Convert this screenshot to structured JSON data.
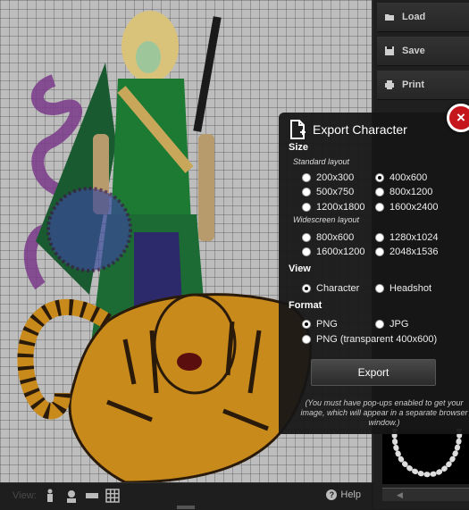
{
  "right_panel": {
    "load_label": "Load",
    "save_label": "Save",
    "print_label": "Print"
  },
  "bottom_bar": {
    "view_label": "View:",
    "help_label": "Help"
  },
  "modal": {
    "title": "Export Character",
    "close_label": "×",
    "size": {
      "heading": "Size",
      "standard_label": "Standard layout",
      "standard_options": [
        "200x300",
        "400x600",
        "500x750",
        "800x1200",
        "1200x1800",
        "1600x2400"
      ],
      "standard_selected": "400x600",
      "widescreen_label": "Widescreen layout",
      "widescreen_options": [
        "800x600",
        "1280x1024",
        "1600x1200",
        "2048x1536"
      ]
    },
    "view": {
      "heading": "View",
      "options": [
        "Character",
        "Headshot"
      ],
      "selected": "Character"
    },
    "format": {
      "heading": "Format",
      "options": [
        "PNG",
        "JPG",
        "PNG (transparent 400x600)"
      ],
      "selected": "PNG"
    },
    "export_label": "Export",
    "note": "(You must have pop-ups enabled to get your image, which will appear in a separate browser window.)"
  },
  "colors": {
    "canvas_bg": "#bdbdbd",
    "modal_bg": "#161616",
    "close_red": "#c4161c",
    "gown_green": "#1c7a33",
    "tiger_orange": "#c98a1c"
  }
}
